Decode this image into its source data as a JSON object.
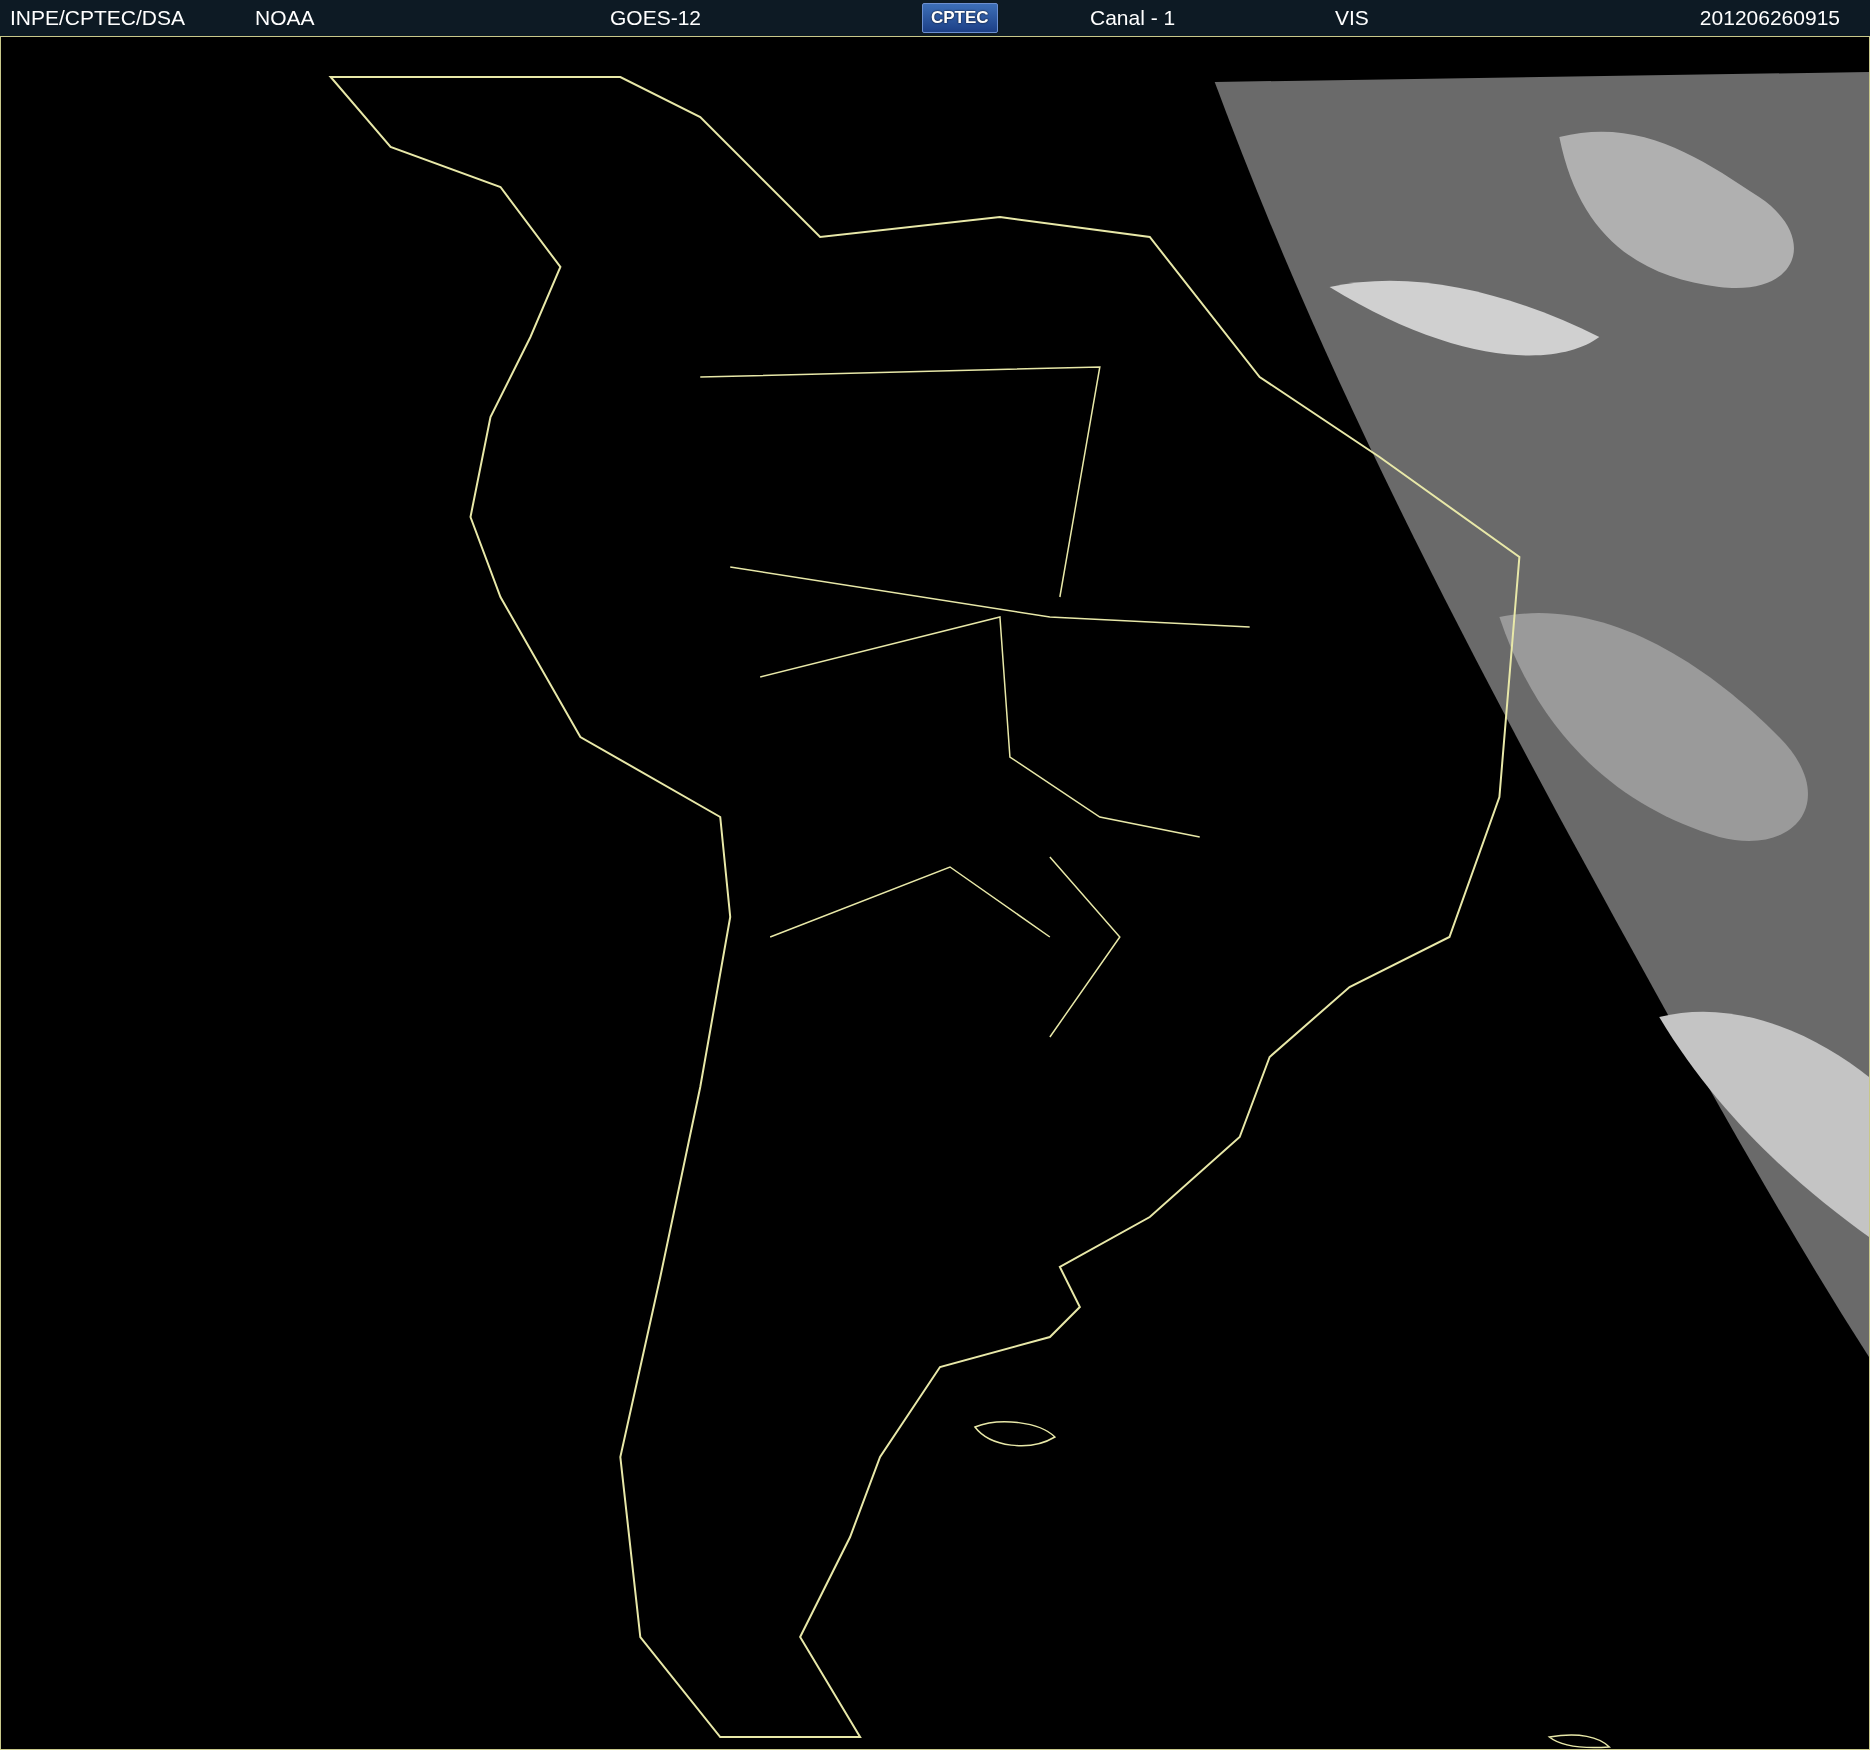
{
  "header": {
    "items": [
      {
        "kind": "text",
        "label": "INPE/CPTEC/DSA"
      },
      {
        "kind": "text",
        "label": "NOAA"
      },
      {
        "kind": "text",
        "label": "GOES-12"
      },
      {
        "kind": "logo",
        "label": "CPTEC"
      },
      {
        "kind": "text",
        "label": "Canal - 1"
      },
      {
        "kind": "text",
        "label": "VIS"
      },
      {
        "kind": "text",
        "label": "201206260915"
      }
    ]
  }
}
